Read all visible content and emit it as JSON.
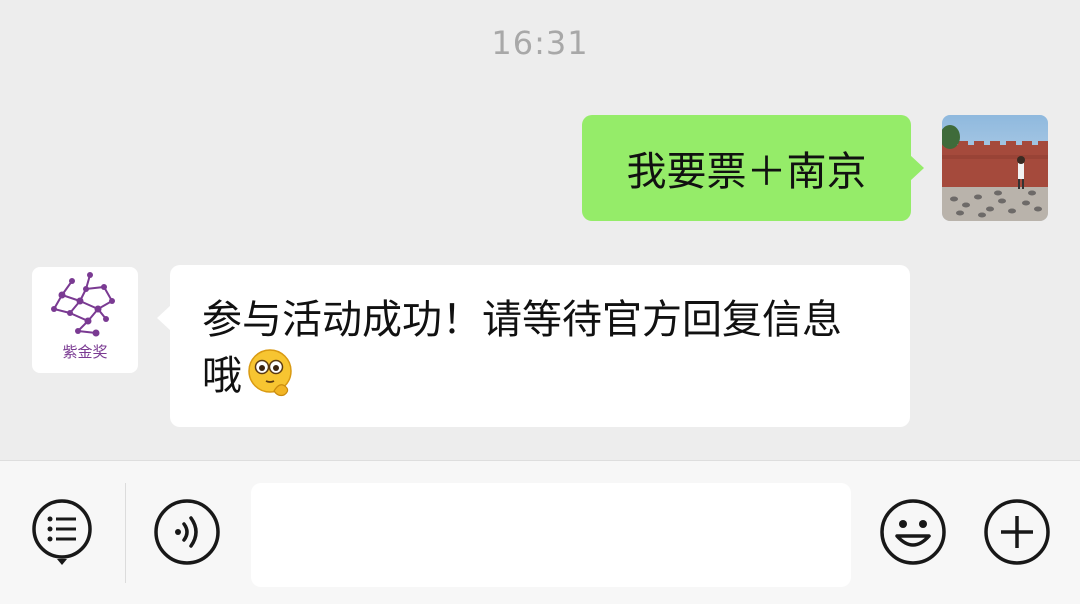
{
  "chat": {
    "timestamp": "16:31",
    "outgoing": {
      "text": "我要票＋南京"
    },
    "incoming": {
      "sender_logo_text": "紫金奖",
      "text": "参与活动成功！请等待官方回复信息哦",
      "emoji": "thinking-face-emoji"
    }
  },
  "input_bar": {
    "menu_icon": "menu-list-icon",
    "voice_icon": "voice-icon",
    "text_value": "",
    "emoji_icon": "smiley-icon",
    "plus_icon": "plus-icon"
  },
  "colors": {
    "background": "#ededed",
    "outgoing_bubble": "#95ec69",
    "incoming_bubble": "#ffffff",
    "brand_purple": "#7a3a92"
  }
}
